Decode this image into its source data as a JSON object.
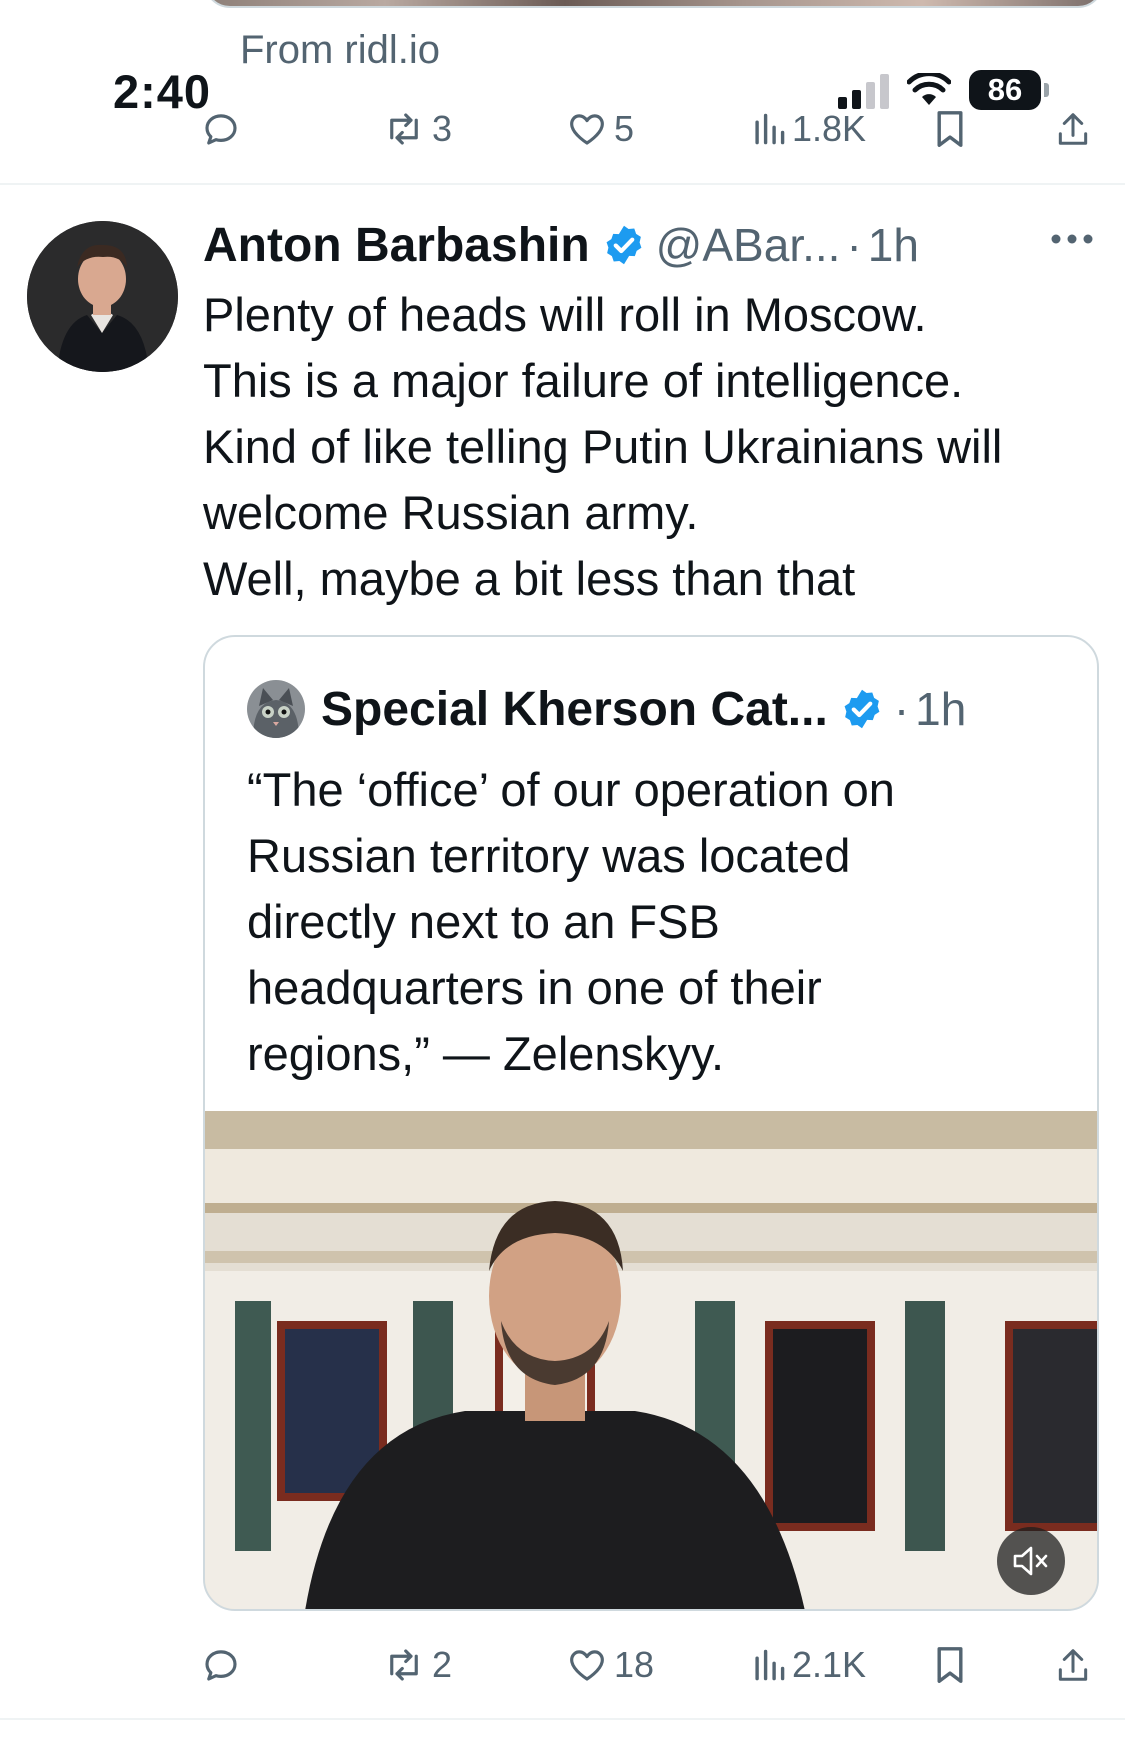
{
  "status_bar": {
    "from_app": "From ridl.io",
    "time": "2:40",
    "battery": "86"
  },
  "prev_post_actions": {
    "reposts": "3",
    "likes": "5",
    "views": "1.8K"
  },
  "tweet": {
    "author_name": "Anton Barbashin",
    "handle": "@ABar...",
    "dot": "·",
    "time": "1h",
    "text_lines": [
      "Plenty of heads will roll in Moscow.",
      "This is a major failure of intelligence.",
      "Kind of like telling Putin Ukrainians will",
      "welcome Russian army.",
      "Well, maybe a bit less than that"
    ],
    "quote": {
      "author_name": "Special Kherson Cat...",
      "dot": "·",
      "time": "1h",
      "text_lines": [
        "“The ‘office’ of our operation on",
        "Russian territory was located",
        "directly next to an FSB",
        "headquarters in one of their",
        "regions,” — Zelenskyy."
      ],
      "media_icon": "mute-icon"
    },
    "actions": {
      "reposts": "2",
      "likes": "18",
      "views": "2.1K"
    }
  },
  "colors": {
    "text_primary": "#0f1419",
    "text_secondary": "#536471",
    "verified_blue": "#1d9bf0",
    "border": "#cfd9de"
  }
}
